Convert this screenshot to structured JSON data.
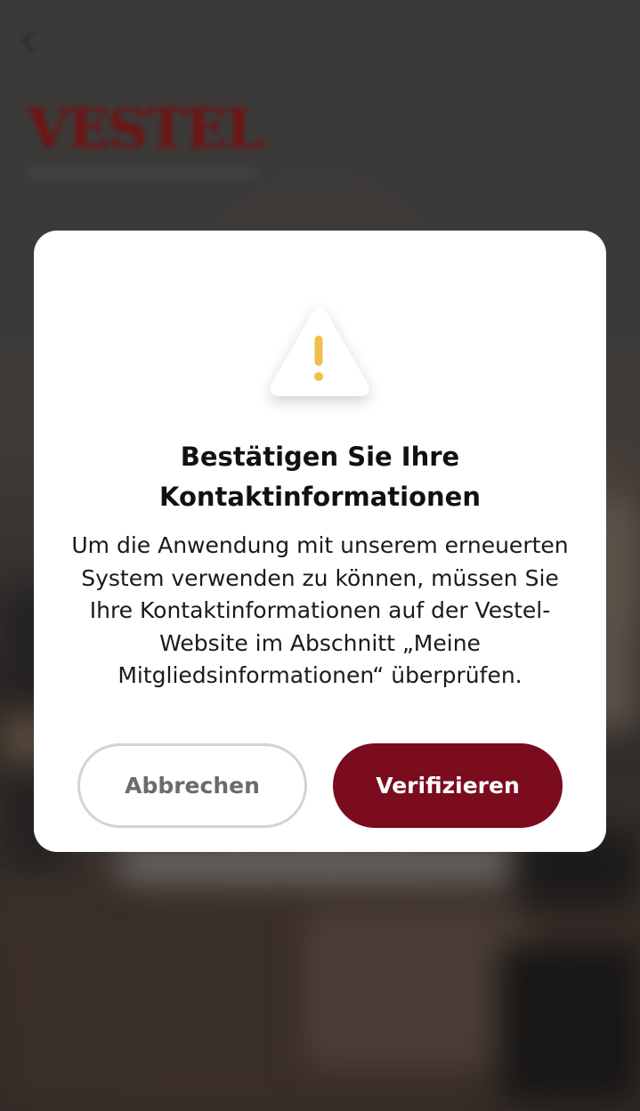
{
  "background": {
    "logo_text": "VESTEL"
  },
  "dialog": {
    "icon": "warning-icon",
    "title_line1": "Bestätigen Sie Ihre",
    "title_line2": "Kontaktinformationen",
    "message_lines": [
      "Um die Anwendung mit unserem erneuerten",
      "System verwenden zu können, müssen Sie",
      "Ihre Kontaktinformationen auf der Vestel-",
      "Website im Abschnitt „Meine",
      "Mitgliedsinformationen“ überprüfen."
    ],
    "cancel_label": "Abbrechen",
    "verify_label": "Verifizieren"
  },
  "colors": {
    "accent": "#7a0c1d",
    "warning": "#f0c04a",
    "overlay": "#3a3735"
  }
}
